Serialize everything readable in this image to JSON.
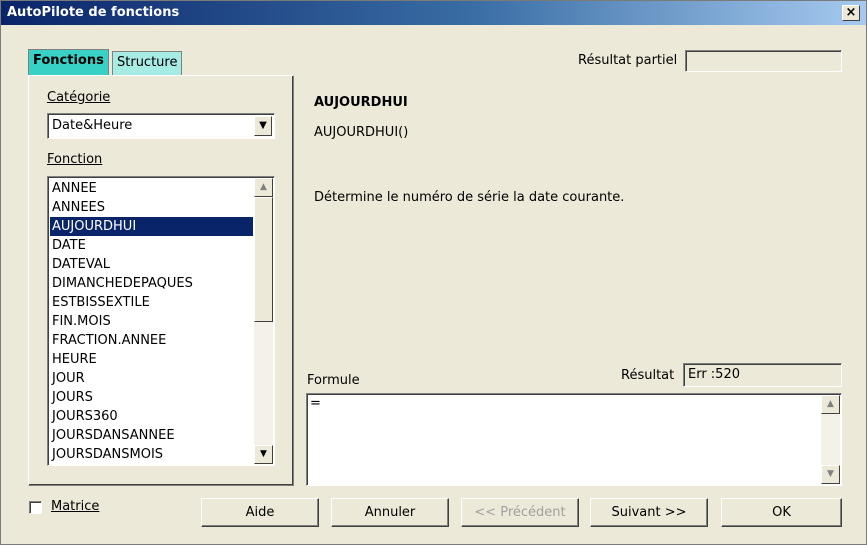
{
  "window": {
    "title": "AutoPilote de fonctions",
    "close_label": "×"
  },
  "tabs": [
    {
      "label": "Fonctions"
    },
    {
      "label": "Structure"
    }
  ],
  "left_panel": {
    "category_label": "Catégorie",
    "category_value": "Date&Heure",
    "function_label": "Fonction",
    "functions": [
      "ANNEE",
      "ANNEES",
      "AUJOURDHUI",
      "DATE",
      "DATEVAL",
      "DIMANCHEDEPAQUES",
      "ESTBISSEXTILE",
      "FIN.MOIS",
      "FRACTION.ANNEE",
      "HEURE",
      "JOUR",
      "JOURS",
      "JOURS360",
      "JOURSDANSANNEE",
      "JOURSDANSMOIS"
    ],
    "selected_function": "AUJOURDHUI"
  },
  "right_panel": {
    "partial_result_label": "Résultat partiel",
    "partial_result_value": "",
    "function_name": "AUJOURDHUI",
    "function_syntax": "AUJOURDHUI()",
    "function_description": "Détermine le numéro de série la date courante.",
    "formula_label": "Formule",
    "formula_value": "=",
    "result_label": "Résultat",
    "result_value": "Err :520"
  },
  "footer": {
    "matrix_label": "Matrice",
    "matrix_checked": false,
    "help_label": "Aide",
    "cancel_label": "Annuler",
    "previous_label": "<< Précédent",
    "next_label": "Suivant >>",
    "ok_label": "OK"
  },
  "icons": {
    "dropdown": "▼",
    "scroll_up": "▲",
    "scroll_down": "▼"
  }
}
